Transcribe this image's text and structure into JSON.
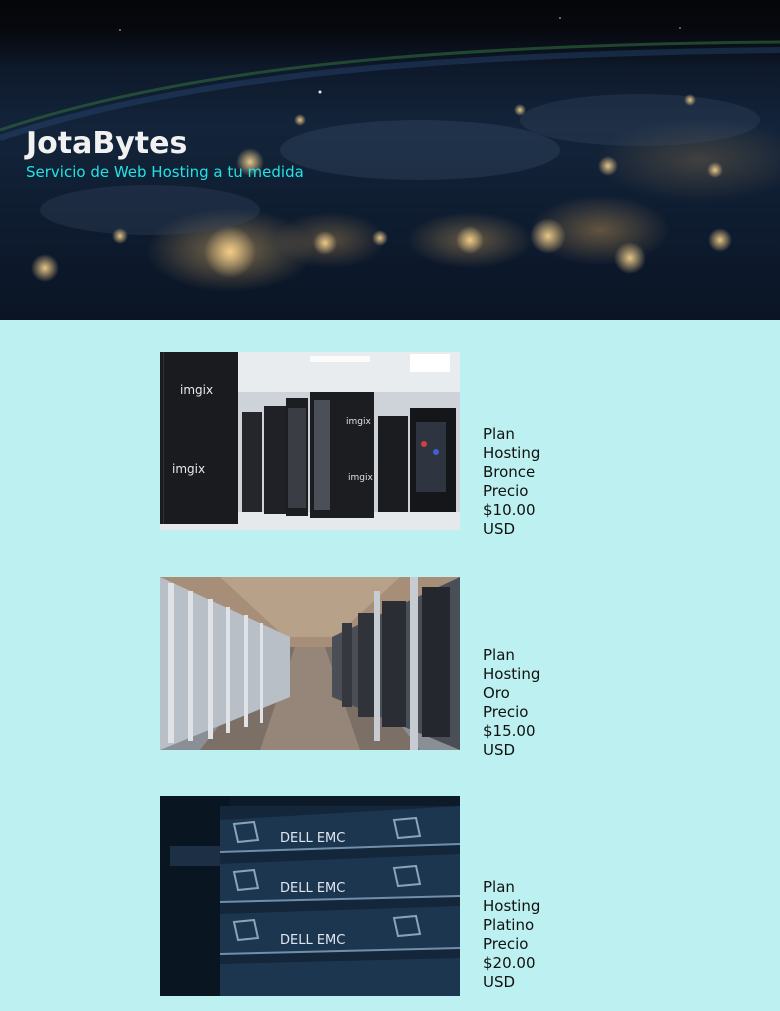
{
  "header": {
    "brand_bold": "Jota",
    "brand_rest": "Bytes",
    "tagline": "Servicio de Web Hosting a tu medida"
  },
  "plans": [
    {
      "name": "Plan Hosting Bronce",
      "price": "Precio $10.00 USD",
      "image_label": "imgix"
    },
    {
      "name": "Plan Hosting Oro",
      "price": "Precio $15.00 USD"
    },
    {
      "name": "Plan Hosting Platino",
      "price": "Precio $20.00 USD",
      "image_label": "DELL EMC"
    }
  ],
  "colors": {
    "page_background": "#bdf0f0",
    "tagline": "#20e4e4",
    "title": "#f1f1f1"
  }
}
